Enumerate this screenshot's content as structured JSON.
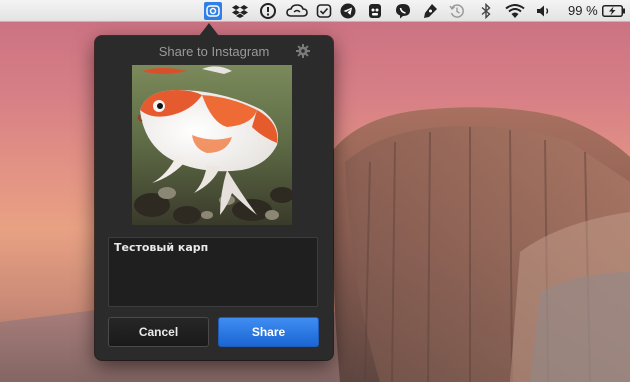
{
  "menubar": {
    "icons": [
      "instagram-share-icon",
      "dropbox-icon",
      "alert-icon",
      "cloud-sync-icon",
      "checklist-icon",
      "telegram-icon",
      "evernote-icon",
      "viber-icon",
      "pen-icon",
      "time-machine-icon",
      "bluetooth-icon",
      "wifi-icon",
      "volume-icon"
    ],
    "battery_text": "99 %",
    "active_icon": "instagram-share-icon",
    "active_color": "#2f7fe6"
  },
  "popover": {
    "title": "Share to Instagram",
    "settings_icon": "gear-icon",
    "photo_subject": "koi fish photo",
    "caption_value": "Тестовый карп",
    "cancel_label": "Cancel",
    "share_label": "Share",
    "share_color": "#2a78e4"
  }
}
